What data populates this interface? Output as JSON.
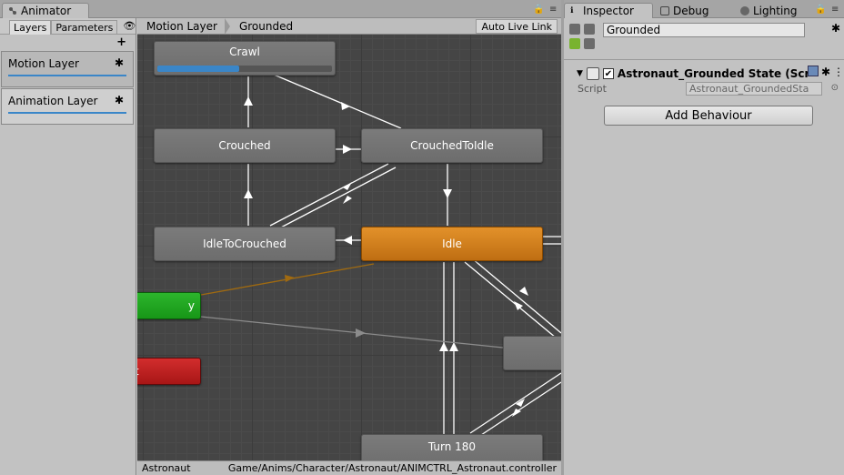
{
  "animator_window": {
    "tab_label": "Animator",
    "left_panel": {
      "tabs": [
        "Layers",
        "Parameters"
      ],
      "layers": [
        {
          "name": "Motion Layer"
        },
        {
          "name": "Animation Layer"
        }
      ]
    },
    "graph": {
      "breadcrumbs": [
        "Motion Layer",
        "Grounded"
      ],
      "live_link_label": "Auto Live Link",
      "states": {
        "crawl": "Crawl",
        "crouched": "Crouched",
        "crouched_to_idle": "CrouchedToIdle",
        "idle_to_crouched": "IdleToCrouched",
        "idle": "Idle",
        "entry": "y",
        "exit": "t",
        "turn_180": "Turn 180"
      },
      "crawl_progress": 0.47,
      "footer": {
        "left": "Astronaut",
        "right": "Game/Anims/Character/Astronaut/ANIMCTRL_Astronaut.controller"
      }
    }
  },
  "inspector_window": {
    "tabs": [
      {
        "label": "Inspector",
        "icon": "info-icon"
      },
      {
        "label": "Debug",
        "icon": "debug-icon"
      },
      {
        "label": "Lighting",
        "icon": "lighting-icon"
      }
    ],
    "state_name": "Grounded",
    "component": {
      "title": "Astronaut_Grounded State (Scr",
      "script_label": "Script",
      "script_value": "Astronaut_GroundedSta"
    },
    "add_behaviour_label": "Add Behaviour"
  },
  "colors": {
    "default_state": "#e2912a",
    "entry_state": "#2cb52c",
    "exit_state": "#d22d2d",
    "accent": "#3a86c8"
  }
}
